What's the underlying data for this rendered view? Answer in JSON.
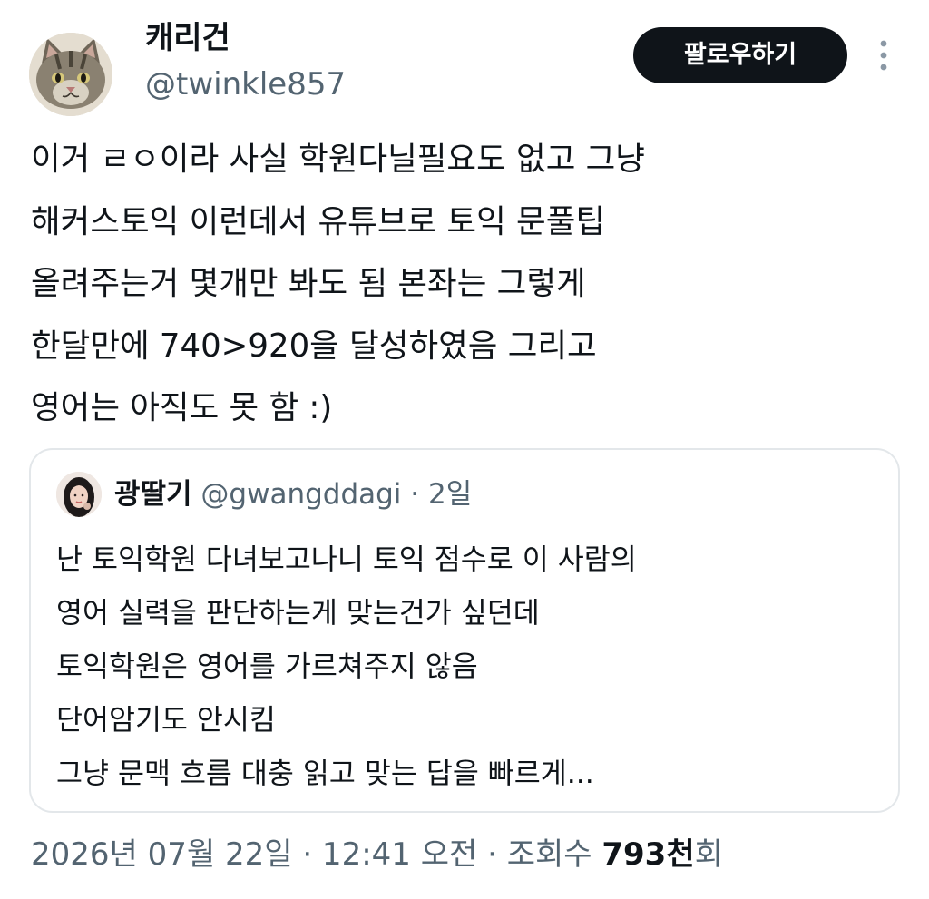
{
  "author": {
    "display_name": "캐리건",
    "handle": "@twinkle857",
    "avatar_icon": "cat-avatar"
  },
  "actions": {
    "follow_label": "팔로우하기",
    "more_icon": "vertical-ellipsis-icon"
  },
  "tweet": {
    "lines": [
      "이거 ㄹㅇ이라 사실 학원다닐필요도 없고 그냥",
      "해커스토익 이런데서 유튜브로 토익 문풀팁",
      "올려주는거 몇개만 봐도 됨 본좌는 그렇게",
      "한달만에 740>920을 달성하였음 그리고",
      "영어는 아직도 못 함 :)"
    ]
  },
  "quote": {
    "display_name": "광딸기",
    "handle": "@gwangddagi",
    "separator": "·",
    "time": "2일",
    "avatar_icon": "portrait-avatar",
    "lines": [
      "난 토익학원 다녀보고나니 토익 점수로 이 사람의",
      "영어 실력을 판단하는게 맞는건가 싶던데",
      "토익학원은 영어를 가르쳐주지 않음",
      "단어암기도 안시킴",
      "그냥 문맥 흐름 대충 읽고 맞는 답을 빠르게..."
    ]
  },
  "meta": {
    "timestamp": "2026년 07월 22일 · 12:41 오전 · 조회수 ",
    "views_count": "793천",
    "views_suffix": "회"
  },
  "colors": {
    "text_primary": "#0f1419",
    "text_secondary": "#536471",
    "follow_bg": "#0f1419",
    "card_border": "#e3e7ea"
  }
}
